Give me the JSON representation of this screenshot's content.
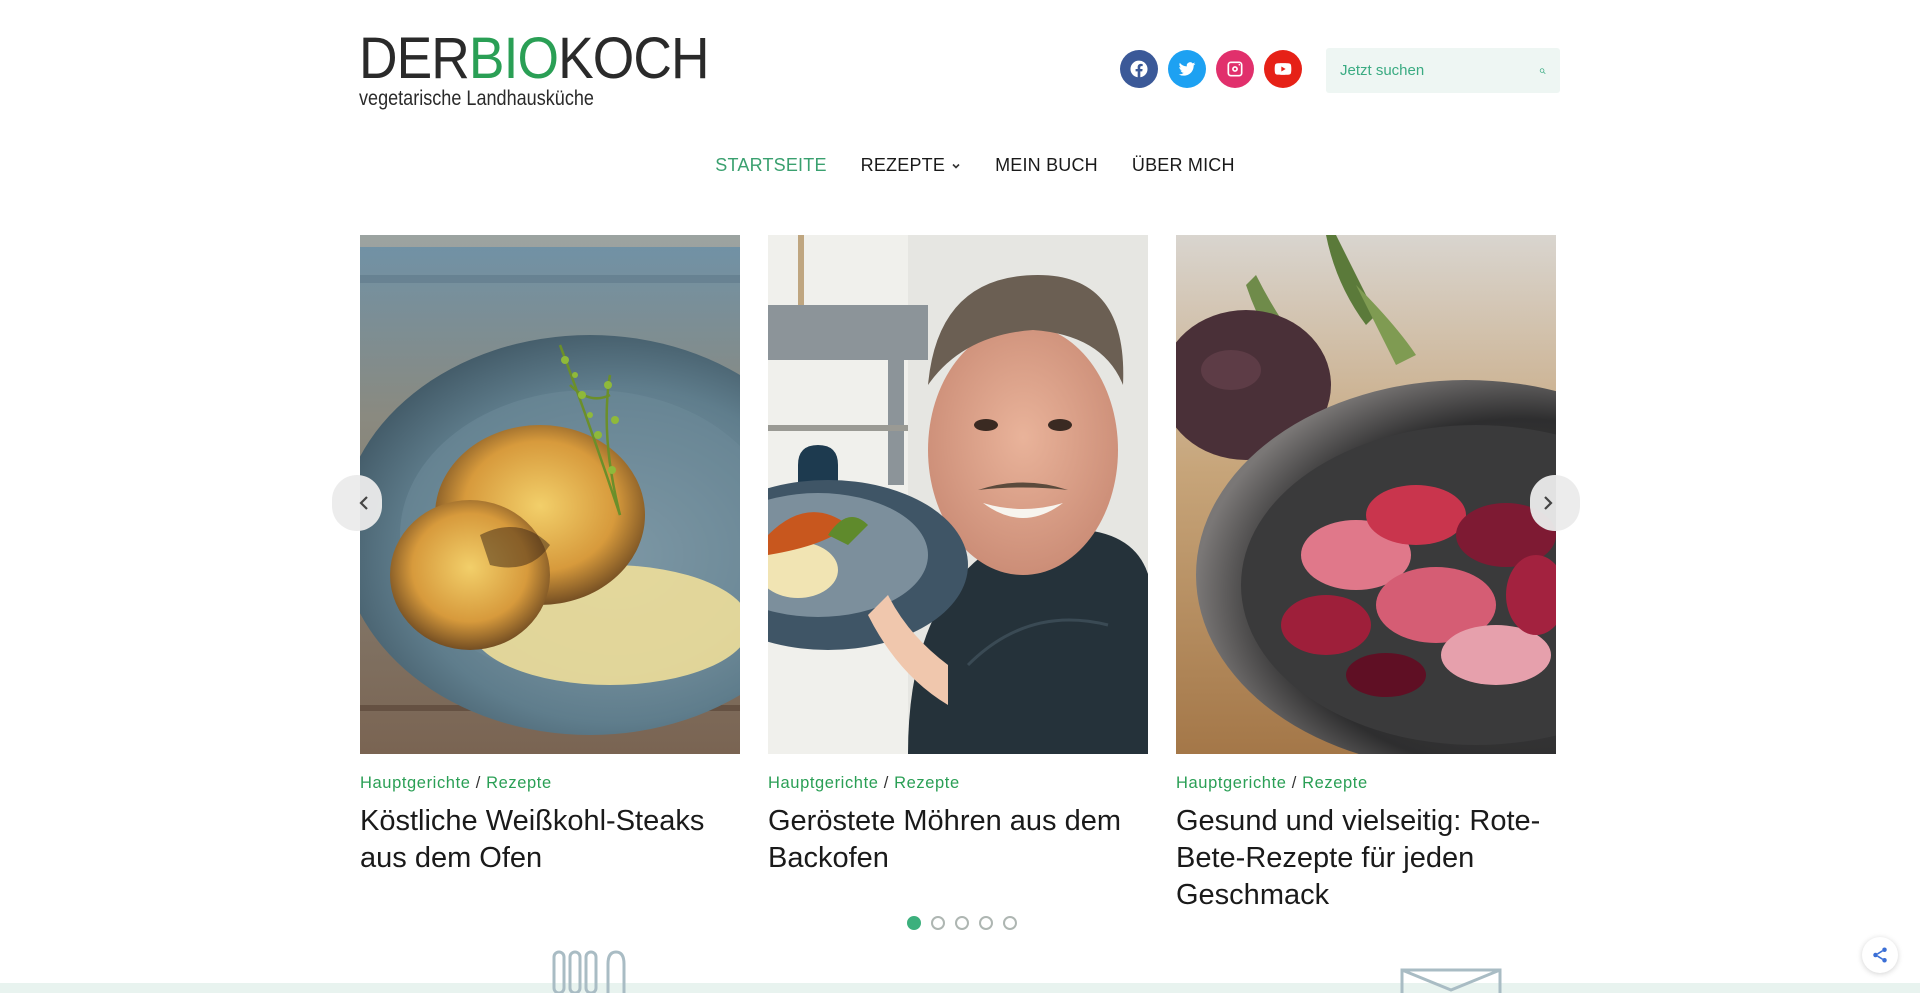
{
  "header": {
    "logo": {
      "part1": "DER",
      "part2": "BIO",
      "part3": "KOCH",
      "tagline": "vegetarische Landhausküche"
    },
    "social": [
      {
        "name": "facebook",
        "color": "#3b5998"
      },
      {
        "name": "twitter",
        "color": "#1da1f2"
      },
      {
        "name": "instagram",
        "color": "#e1306c"
      },
      {
        "name": "youtube",
        "color": "#e62117"
      }
    ],
    "search": {
      "placeholder": "Jetzt suchen"
    }
  },
  "nav": {
    "items": [
      {
        "label": "STARTSEITE",
        "active": true
      },
      {
        "label": "REZEPTE",
        "dropdown": true
      },
      {
        "label": "MEIN BUCH"
      },
      {
        "label": "ÜBER MICH"
      }
    ]
  },
  "carousel": {
    "slides": [
      {
        "cat1": "Hauptgerichte",
        "sep": "/",
        "cat2": "Rezepte",
        "title": "Köstliche Weißkohl-Steaks aus dem Ofen",
        "image": "roasted cabbage steak on blue plate with thyme"
      },
      {
        "cat1": "Hauptgerichte",
        "sep": "/",
        "cat2": "Rezepte",
        "title": "Geröstete Möhren aus dem Backofen",
        "image": "smiling chef holding plate in kitchen"
      },
      {
        "cat1": "Hauptgerichte",
        "sep": "/",
        "cat2": "Rezepte",
        "title": "Gesund und vielseitig: Rote-Bete-Rezepte für jeden Geschmack",
        "image": "beetroot and apple in iron pan"
      }
    ],
    "dots": 5,
    "active_dot": 0
  },
  "colors": {
    "accent": "#2a9f55",
    "accent_light": "#3cb07d",
    "search_bg": "#eef6f3"
  }
}
